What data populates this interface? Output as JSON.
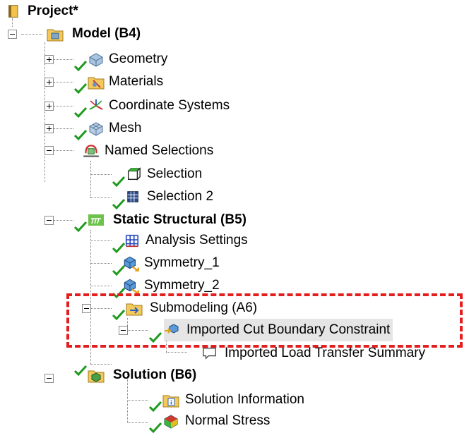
{
  "tree": {
    "root": {
      "label": "Project*",
      "icon": "project-book-icon"
    },
    "model": {
      "label": "Model (B4)",
      "icon": "model-folder-icon"
    },
    "geometry": {
      "label": "Geometry",
      "icon": "geometry-icon"
    },
    "materials": {
      "label": "Materials",
      "icon": "materials-folder-icon"
    },
    "coordinate_systems": {
      "label": "Coordinate Systems",
      "icon": "coordinate-systems-icon"
    },
    "mesh": {
      "label": "Mesh",
      "icon": "mesh-icon"
    },
    "named_selections": {
      "label": "Named Selections",
      "icon": "named-selections-icon"
    },
    "selection": {
      "label": "Selection",
      "icon": "selection-face-icon"
    },
    "selection_2": {
      "label": "Selection 2",
      "icon": "selection-grid-icon"
    },
    "static_structural": {
      "label": "Static Structural (B5)",
      "icon": "static-structural-icon"
    },
    "analysis_settings": {
      "label": "Analysis Settings",
      "icon": "analysis-settings-icon"
    },
    "symmetry_1": {
      "label": "Symmetry_1",
      "icon": "symmetry-icon"
    },
    "symmetry_2": {
      "label": "Symmetry_2",
      "icon": "symmetry-icon"
    },
    "submodeling": {
      "label": "Submodeling (A6)",
      "icon": "submodeling-folder-icon"
    },
    "imported_cut_boundary": {
      "label": "Imported Cut Boundary Constraint",
      "icon": "imported-cut-boundary-icon"
    },
    "load_transfer_summary": {
      "label": "Imported Load Transfer Summary",
      "icon": "comment-icon"
    },
    "solution": {
      "label": "Solution (B6)",
      "icon": "solution-folder-icon"
    },
    "solution_information": {
      "label": "Solution Information",
      "icon": "solution-information-icon"
    },
    "normal_stress": {
      "label": "Normal Stress",
      "icon": "normal-stress-icon"
    }
  },
  "colors": {
    "check": "#1e9a1e",
    "highlight_border": "#e41e1e",
    "selected_row": "#e5e5e5",
    "tree_lines": "#7f7f7f"
  }
}
